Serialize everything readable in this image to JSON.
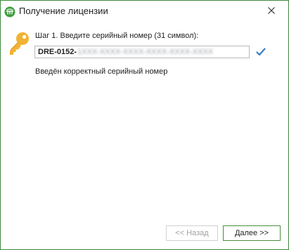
{
  "window": {
    "title": "Получение лицензии",
    "app_icon": "license-app-icon",
    "close_icon": "close-icon"
  },
  "step": {
    "label": "Шаг 1. Введите серийный номер (31 символ):",
    "icon": "key-icon"
  },
  "serial_field": {
    "prefix": "DRE-0152-",
    "masked_part": "1XXX-XXXX-XXXX-XXXX-XXXX-XXXX",
    "validity_icon": "checkmark-icon"
  },
  "status": {
    "message": "Введён корректный серийный номер"
  },
  "buttons": {
    "back_label": "<< Назад",
    "back_enabled": false,
    "next_label": "Далее >>",
    "next_enabled": true
  },
  "colors": {
    "window_border": "#3c8a3c",
    "key": "#f2b233",
    "check": "#3b7fc4",
    "next_border": "#4a8f3c"
  }
}
